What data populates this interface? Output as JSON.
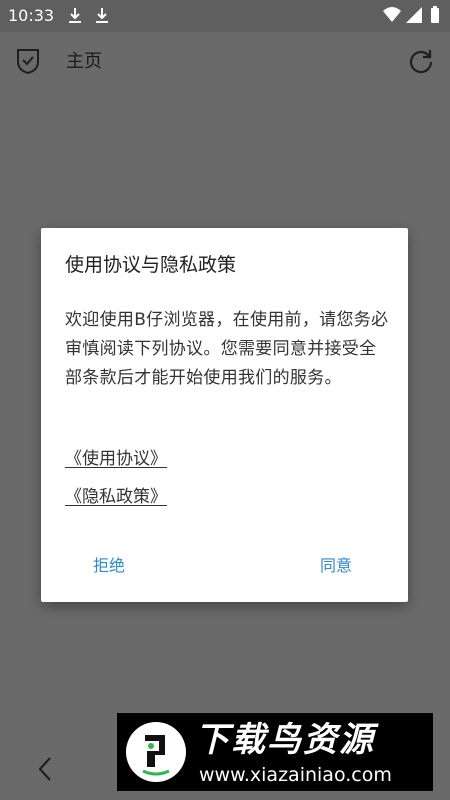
{
  "status_bar": {
    "time": "10:33"
  },
  "app_bar": {
    "title": "主页"
  },
  "dialog": {
    "title": "使用协议与隐私政策",
    "body": "欢迎使用B仔浏览器，在使用前，请您务必审慎阅读下列协议。您需要同意并接受全部条款后才能开始使用我们的服务。",
    "links": [
      "《使用协议》",
      "《隐私政策》"
    ],
    "reject_label": "拒绝",
    "agree_label": "同意"
  },
  "watermark": {
    "name": "下载鸟资源",
    "url": "www.xiazainiao.com"
  },
  "colors": {
    "accent": "#2f8ad4",
    "overlay": "#6a6a6a",
    "dialog_bg": "#ffffff"
  },
  "icons": {
    "app_bar_left": "shield-check-icon",
    "app_bar_right": "refresh-icon",
    "status_left": [
      "download-icon",
      "download-icon"
    ],
    "status_right": [
      "wifi-icon",
      "signal-icon",
      "battery-icon"
    ],
    "bottom": "back-chevron-icon"
  }
}
